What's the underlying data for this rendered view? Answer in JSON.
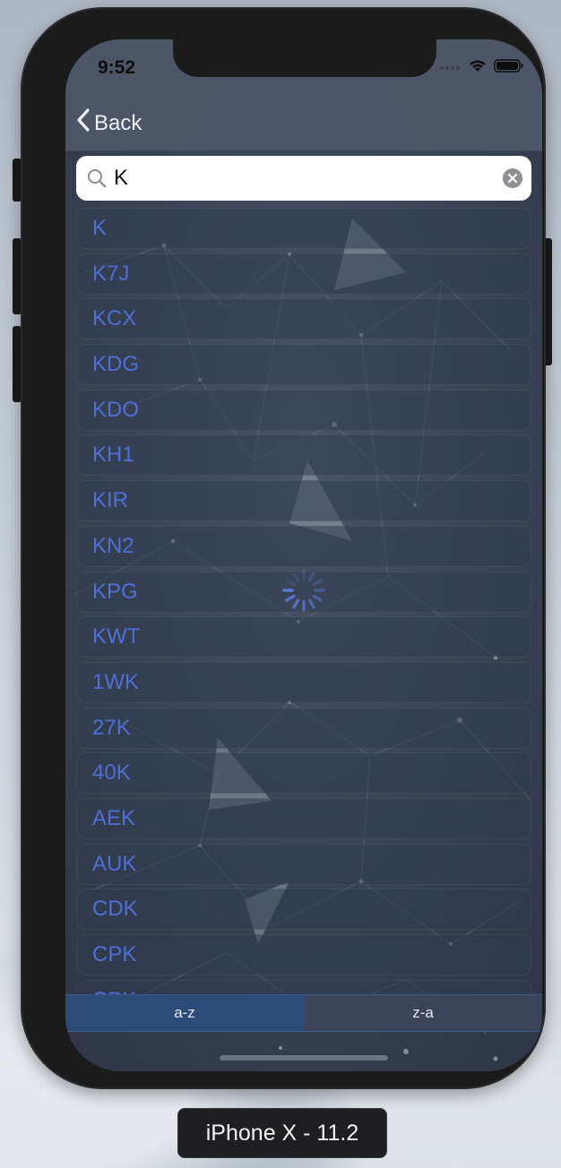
{
  "status_bar": {
    "time": "9:52"
  },
  "nav": {
    "back_label": "Back"
  },
  "search": {
    "value": "K",
    "placeholder": ""
  },
  "results": [
    "K",
    "K7J",
    "KCX",
    "KDG",
    "KDO",
    "KH1",
    "KIR",
    "KN2",
    "KPG",
    "KWT",
    "1WK",
    "27K",
    "40K",
    "AEK",
    "AUK",
    "CDK",
    "CPK",
    "CPK"
  ],
  "sort": {
    "az_label": "a-z",
    "za_label": "z-a"
  },
  "simulator": {
    "device_label": "iPhone X - 11.2"
  },
  "colors": {
    "item_text": "#4f6fd6",
    "nav_bg": "#4d5768",
    "segment_active": "#2c4b78"
  }
}
